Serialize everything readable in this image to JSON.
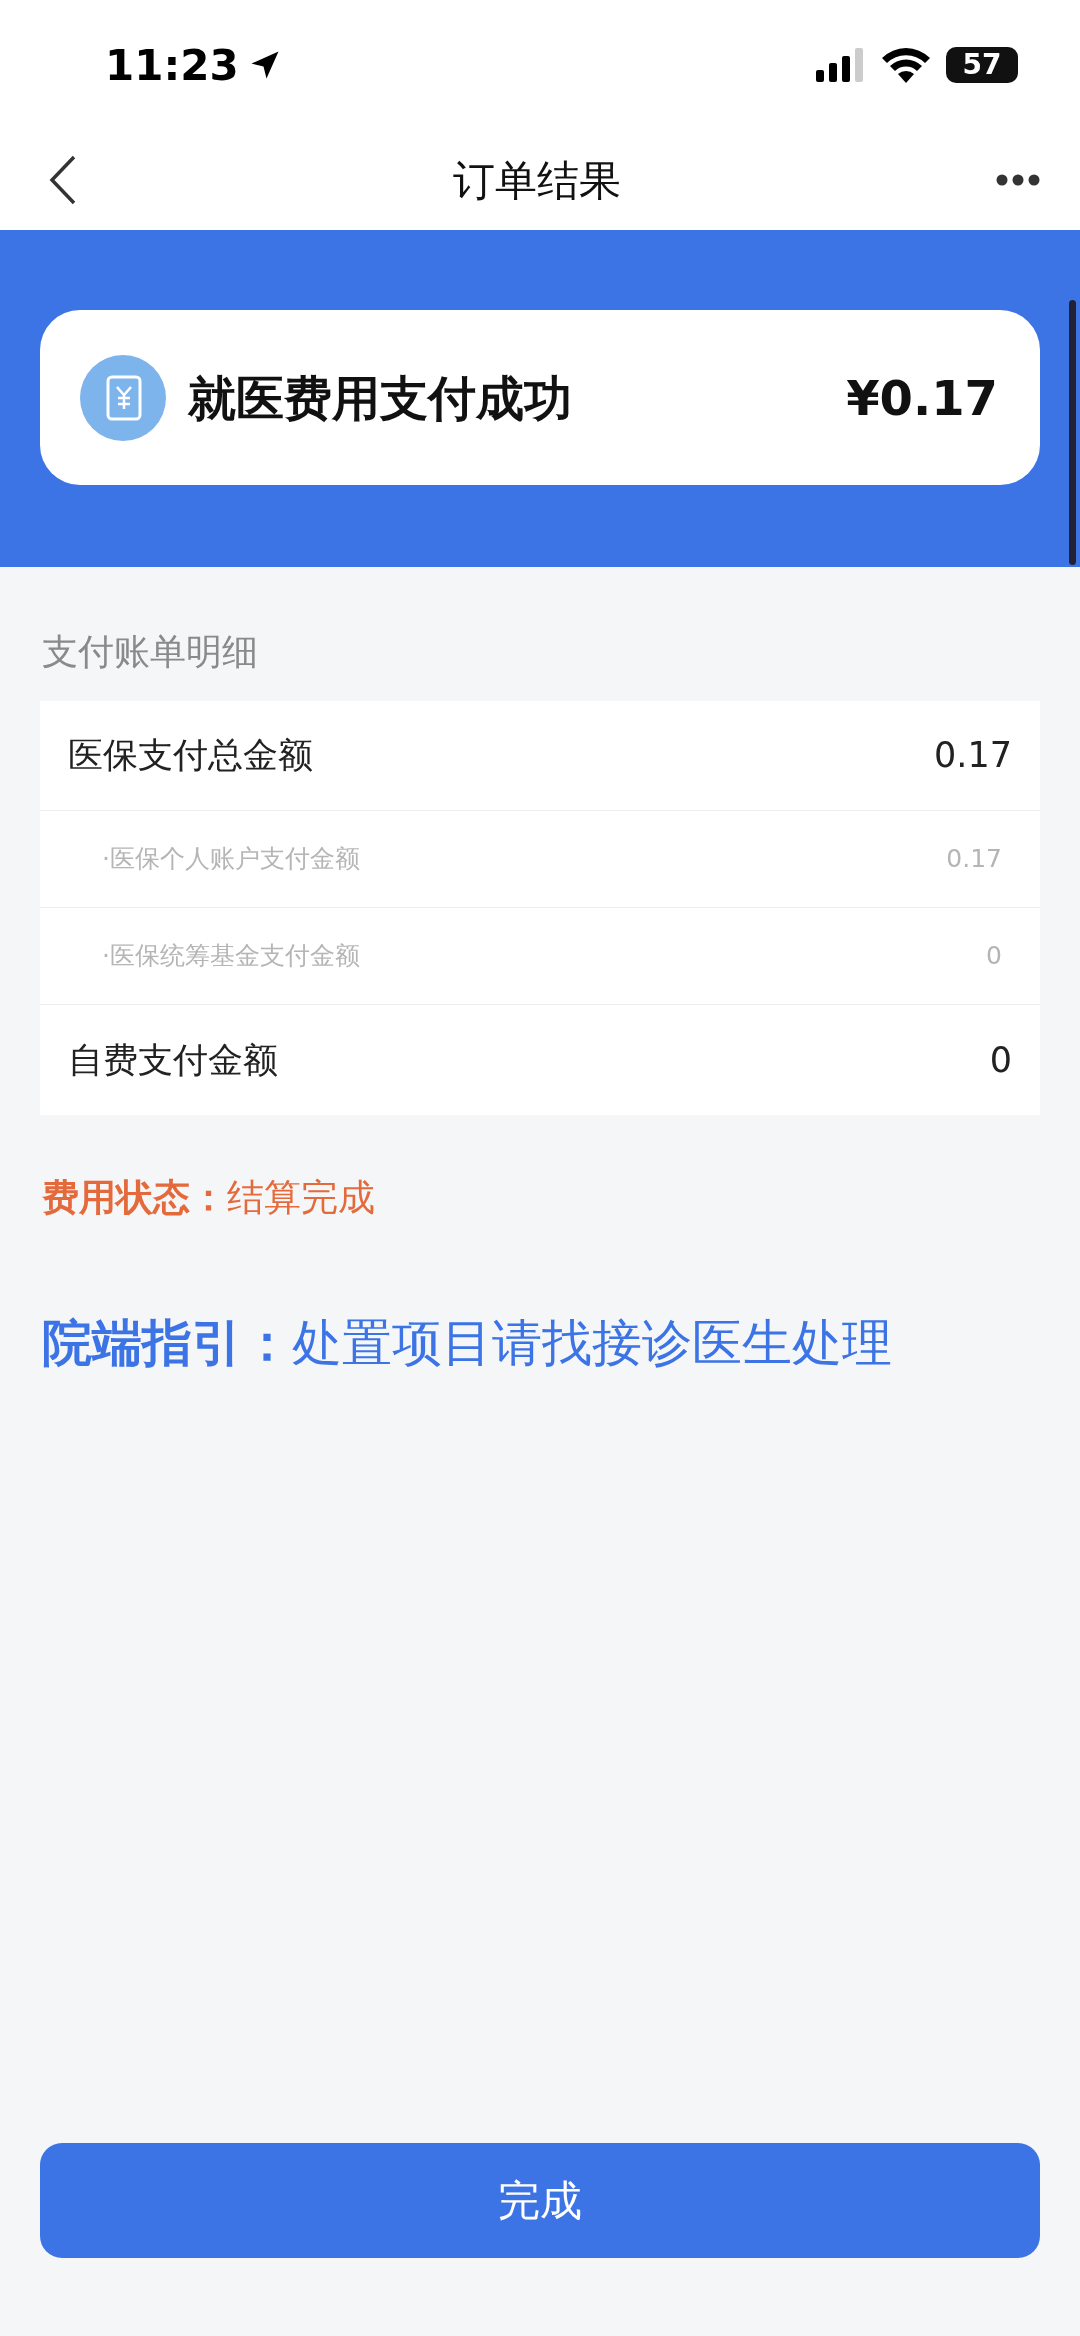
{
  "status_bar": {
    "time": "11:23",
    "battery": "57"
  },
  "nav": {
    "title": "订单结果"
  },
  "result": {
    "title": "就医费用支付成功",
    "amount": "¥0.17"
  },
  "bill": {
    "title": "支付账单明细",
    "rows": [
      {
        "kind": "main",
        "label": "医保支付总金额",
        "value": "0.17"
      },
      {
        "kind": "sub",
        "label": "·医保个人账户支付金额",
        "value": "0.17"
      },
      {
        "kind": "sub",
        "label": "·医保统筹基金支付金额",
        "value": "0"
      },
      {
        "kind": "main",
        "label": "自费支付金额",
        "value": "0"
      }
    ]
  },
  "fee_status": {
    "label": "费用状态：",
    "value": "结算完成"
  },
  "guide": {
    "label": "院端指引：",
    "text": "处置项目请找接诊医生处理"
  },
  "done_button": "完成"
}
